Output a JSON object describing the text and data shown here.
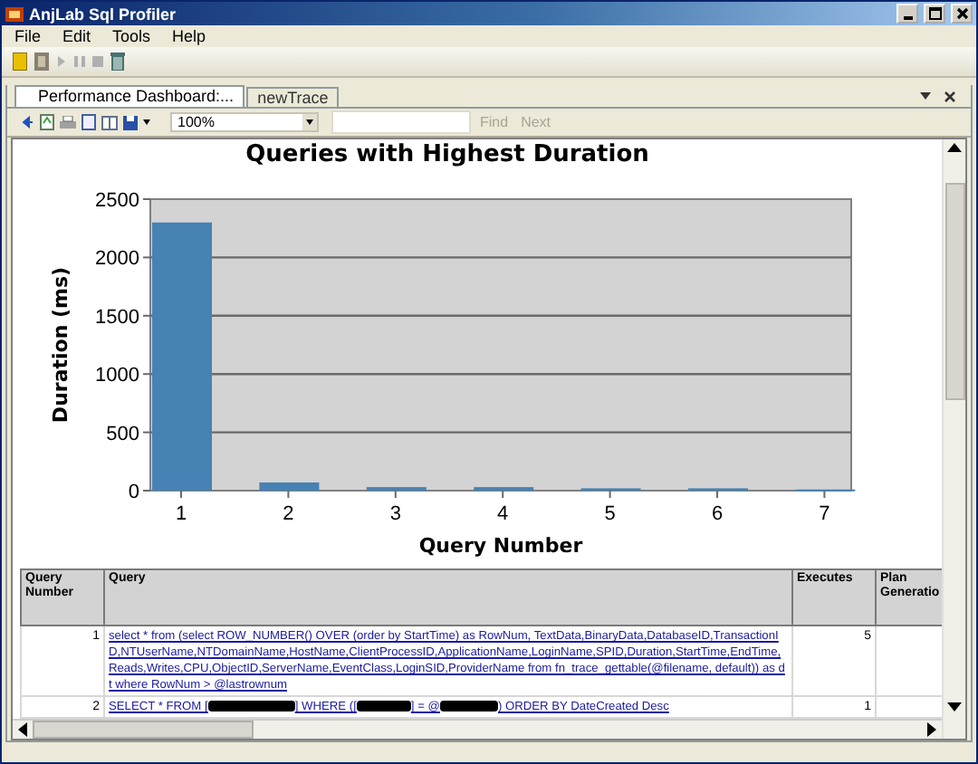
{
  "window": {
    "title": "AnjLab Sql Profiler"
  },
  "menu": [
    {
      "label": "File"
    },
    {
      "label": "Edit"
    },
    {
      "label": "Tools"
    },
    {
      "label": "Help"
    }
  ],
  "document_tabs": [
    {
      "label": "Performance Dashboard:...",
      "selected": true
    },
    {
      "label": "newTrace",
      "selected": false
    }
  ],
  "report_toolbar": {
    "zoom": "100%",
    "find": {
      "label": "Find",
      "disabled": true
    },
    "next": {
      "label": "Next",
      "disabled": true
    }
  },
  "chart_data": {
    "type": "bar",
    "title": "Queries with Highest Duration",
    "xlabel": "Query Number",
    "ylabel": "Duration (ms)",
    "categories": [
      "1",
      "2",
      "3",
      "4",
      "5",
      "6",
      "7"
    ],
    "series": [
      {
        "color": "#4682b4",
        "values": [
          2300,
          70,
          30,
          30,
          20,
          20,
          10
        ]
      }
    ],
    "ylim": [
      0,
      2500
    ],
    "yticks": [
      0,
      500,
      1000,
      1500,
      2000,
      2500
    ],
    "grid": true
  },
  "table": {
    "columns": [
      "Query Number",
      "Query",
      "Executes",
      "Plan Generatio"
    ],
    "rows": [
      {
        "number": "1",
        "query_segments": [
          "select * from (select ROW_NUMBER() OVER (order by StartTime) as RowNum, TextData,BinaryData,DatabaseID,TransactionID,NTUserName,NTDomainName,HostName,ClientProcessID,ApplicationName,LoginName,SPID,Duration,StartTime,EndTime,Reads,Writes,CPU,ObjectID,ServerName,EventClass,LoginSID,ProviderName from fn_trace_gettable(@filename, default)) as dt where RowNum > @lastrownum"
        ],
        "executes": "5"
      },
      {
        "number": "2",
        "query_segments": [
          "SELECT * FROM [",
          "] WHERE ([",
          "] = @",
          ") ORDER BY DateCreated Desc"
        ],
        "executes": "1"
      }
    ]
  }
}
